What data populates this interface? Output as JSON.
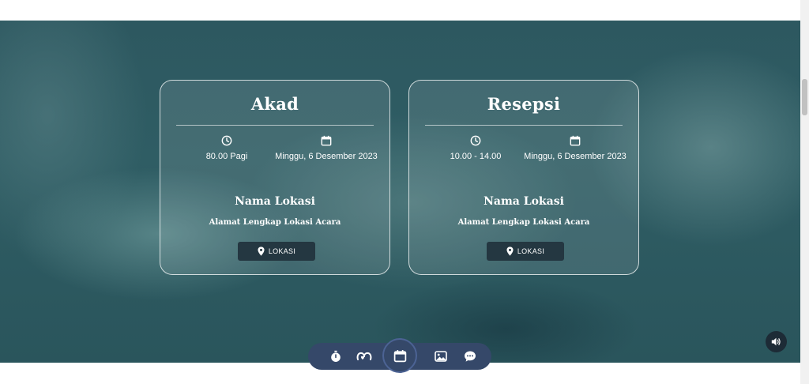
{
  "events": [
    {
      "title": "Akad",
      "time": "80.00 Pagi",
      "date": "Minggu, 6 Desember 2023",
      "location_name": "Nama Lokasi",
      "location_address": "Alamat Lengkap Lokasi Acara",
      "button_label": "LOKASI"
    },
    {
      "title": "Resepsi",
      "time": "10.00 - 14.00",
      "date": "Minggu, 6 Desember 2023",
      "location_name": "Nama Lokasi",
      "location_address": "Alamat Lengkap Lokasi Acara",
      "button_label": "LOKASI"
    }
  ],
  "nav": {
    "items": [
      "stopwatch-icon",
      "couple-icon",
      "calendar-icon",
      "gallery-icon",
      "chat-icon"
    ],
    "active": "calendar-icon"
  },
  "audio_icon": "speaker-icon",
  "colors": {
    "nav_bg": "#354869",
    "button_bg": "#243741",
    "hero_tint": "#2f5d64"
  }
}
